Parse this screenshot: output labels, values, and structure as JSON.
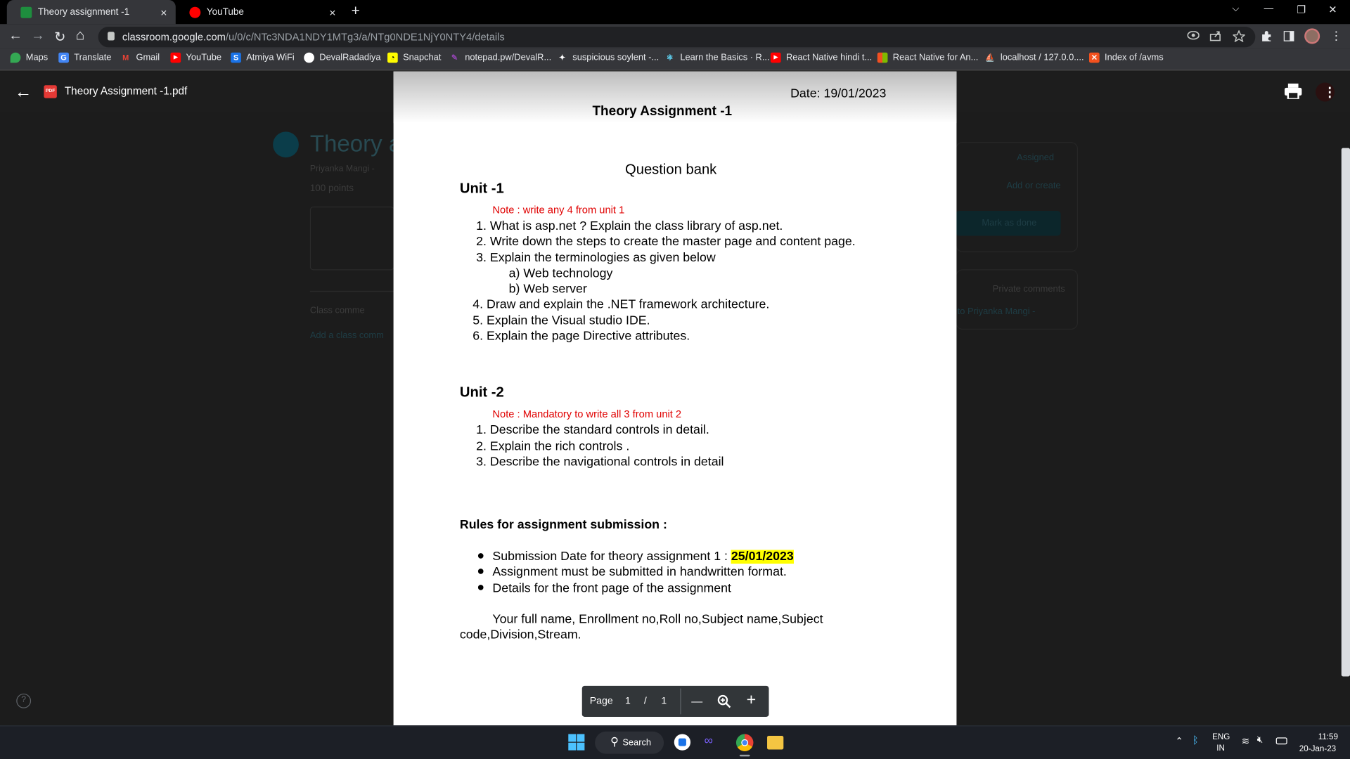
{
  "tabs": [
    {
      "title": "Theory assignment -1",
      "close": "×"
    },
    {
      "title": "YouTube",
      "close": "×"
    }
  ],
  "new_tab": "+",
  "window_controls": {
    "dropdown": "⌵",
    "minimize": "—",
    "restore": "❐",
    "close": "✕"
  },
  "nav": {
    "back": "←",
    "forward": "→",
    "reload": "↻",
    "home": "⌂"
  },
  "url": {
    "host": "classroom.google.com",
    "path": "/u/0/c/NTc3NDA1NDY1MTg3/a/NTg0NDE1NjY0NTY4/details"
  },
  "bookmarks": [
    "Maps",
    "Translate",
    "Gmail",
    "YouTube",
    "Atmiya WiFi",
    "DevalRadadiya",
    "Snapchat",
    "notepad.pw/DevalR...",
    "suspicious soylent -...",
    "Learn the Basics · R...",
    "React Native hindi t...",
    "React Native for An...",
    "localhost / 127.0.0....",
    "Index of /avms"
  ],
  "viewer": {
    "back": "←",
    "pdf_badge": "PDF",
    "filename": "Theory Assignment -1.pdf"
  },
  "background": {
    "title": "Theory a",
    "author": "Priyanka Mangi - ",
    "points": "100 points",
    "assigned": "Assigned",
    "add_or_create": "Add or create",
    "mark_done": "Mark as done",
    "class_comments": "Class comme",
    "add_comment": "Add a class comm",
    "private_comments": "Private comments",
    "to_teacher": "to Priyanka Mangi -",
    "help": "?"
  },
  "doc": {
    "date": "Date: 19/01/2023",
    "title": "Theory Assignment -1",
    "question_bank": "Question bank",
    "unit1": {
      "heading": "Unit -1",
      "note": "Note :  write any 4 from unit 1",
      "items": [
        "1.  What is asp.net ? Explain the class library of asp.net.",
        "2.  Write down the steps to create the master page and content page.",
        "3.  Explain the terminologies  as given below"
      ],
      "sub": [
        "a)  Web technology",
        "b)  Web server"
      ],
      "items2": [
        "4. Draw and explain the .NET framework architecture.",
        "5. Explain  the Visual studio IDE.",
        "6. Explain the page Directive attributes."
      ]
    },
    "unit2": {
      "heading": "Unit -2",
      "note": "Note : Mandatory to write all 3 from unit 2",
      "items": [
        "1.  Describe the standard controls in detail.",
        "2.  Explain the rich controls .",
        "3.  Describe the navigational controls in detail"
      ]
    },
    "rules": {
      "heading": "Rules for assignment submission :",
      "bullet1_text": "Submission Date for theory assignment 1 : ",
      "bullet1_date": "25/01/2023",
      "bullet2": "Assignment  must be submitted in handwritten format.",
      "bullet3": "Details for the front page of the assignment",
      "details_line1": "Your full name, Enrollment no,Roll no,Subject name,Subject",
      "details_line2": "code,Division,Stream."
    }
  },
  "page_control": {
    "label": "Page",
    "current": "1",
    "sep": "/",
    "total": "1",
    "zoom_out": "—",
    "zoom_in": "+"
  },
  "taskbar": {
    "search": "Search",
    "lang_top": "ENG",
    "lang_bottom": "IN",
    "time": "11:59",
    "date": "20-Jan-23"
  },
  "colors": {
    "note_red": "#e00000",
    "highlight": "#ffff00",
    "tab_active": "#35363a"
  }
}
